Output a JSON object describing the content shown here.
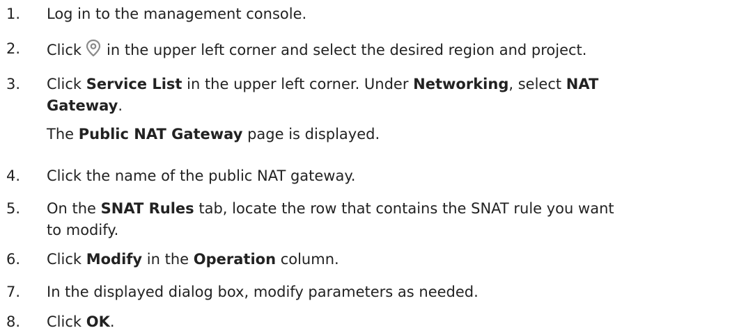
{
  "steps": [
    {
      "number": "1.",
      "text": "Log in to the management console."
    },
    {
      "number": "2.",
      "before_icon": "Click",
      "icon": "location-pin-icon",
      "after_icon": "in the upper left corner and select the desired region and project."
    },
    {
      "number": "3.",
      "t1": "Click ",
      "b1": "Service List",
      "t2": " in the upper left corner. Under ",
      "b2": "Networking",
      "t3": ", select ",
      "b3": "NAT",
      "b4": "Gateway",
      "t4": ".",
      "note_t1": "The ",
      "note_b1": "Public NAT Gateway",
      "note_t2": " page is displayed."
    },
    {
      "number": "4.",
      "text": "Click the name of the public NAT gateway."
    },
    {
      "number": "5.",
      "t1": "On the ",
      "b1": "SNAT Rules",
      "t2": " tab, locate the row that contains the SNAT rule you want",
      "t3": "to modify."
    },
    {
      "number": "6.",
      "t1": "Click ",
      "b1": "Modify",
      "t2": " in the ",
      "b2": "Operation",
      "t3": " column."
    },
    {
      "number": "7.",
      "text": "In the displayed dialog box, modify parameters as needed."
    },
    {
      "number": "8.",
      "t1": "Click ",
      "b1": "OK",
      "t2": "."
    }
  ],
  "colors": {
    "text": "#222222",
    "icon_stroke": "#8a8a8a",
    "background": "#ffffff"
  }
}
